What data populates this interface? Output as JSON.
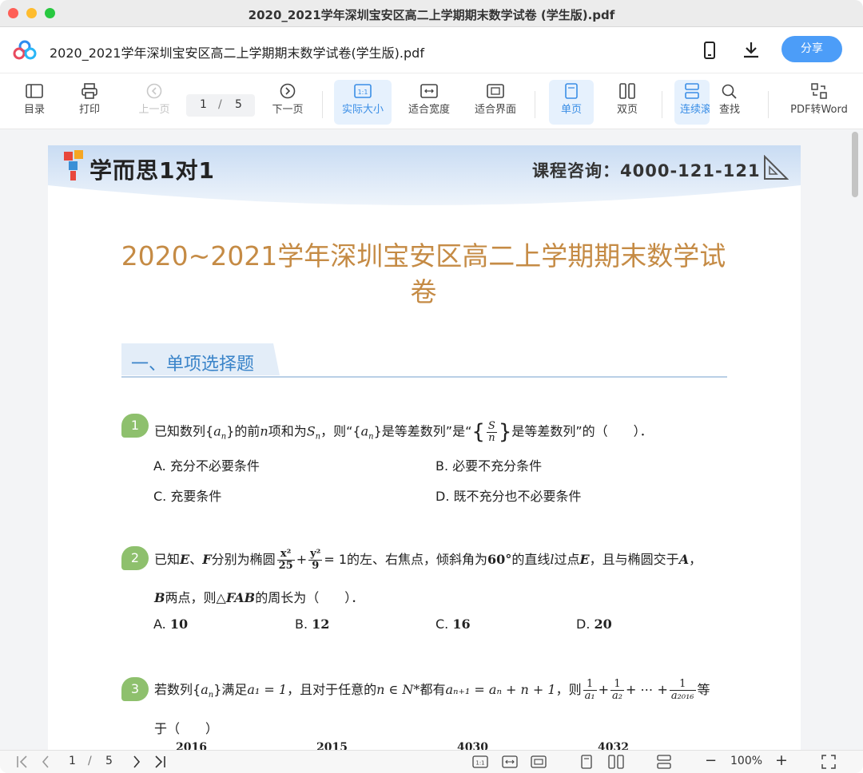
{
  "window": {
    "title": "2020_2021学年深圳宝安区高二上学期期末数学试卷 (学生版).pdf"
  },
  "header": {
    "filename": "2020_2021学年深圳宝安区高二上学期期末数学试卷(学生版).pdf",
    "share_label": "分享"
  },
  "toolbar": {
    "toc": "目录",
    "print": "打印",
    "prev": "上一页",
    "current_page": "1",
    "sep": "/",
    "total_pages": "5",
    "next": "下一页",
    "actual_size": "实际大小",
    "fit_width": "适合宽度",
    "fit_page": "适合界面",
    "single": "单页",
    "double": "双页",
    "continuous": "连续滚",
    "find": "查找",
    "pdf_to_word": "PDF转Word"
  },
  "page": {
    "brand": "学而思1对1",
    "consult": "课程咨询：4000-121-121",
    "title_line1": "2020~2021学年深圳宝安区高二上学期期末数学试",
    "title_line2": "卷",
    "section": "一、单项选择题",
    "q1": {
      "num": "1",
      "t1": "已知数列{",
      "an": "a",
      "sub_n": "n",
      "t2": "}的前",
      "n": "n",
      "t3": "项和为",
      "S": "S",
      "t4": "，则“{",
      "t5": "}是等差数列”是“",
      "frac_num": "S",
      "frac_den": "n",
      "t6": "是等差数列”的（　　）．",
      "A": "A.  充分不必要条件",
      "B": "B.  必要不充分条件",
      "C": "C.  充要条件",
      "D": "D.  既不充分也不必要条件"
    },
    "q2": {
      "num": "2",
      "t1": "已知",
      "E": "E",
      "t2": "、",
      "F": "F",
      "t3": "分别为椭圆",
      "fx_num": "x²",
      "fx_den": "25",
      "plus": "+",
      "fy_num": "y²",
      "fy_den": "9",
      "t4": "= 1的左、右焦点，倾斜角为",
      "deg": "60°",
      "t5": "的直线",
      "l": "l",
      "t6": "过点",
      "t7": "，且与椭圆交于",
      "A": "A",
      "t8": "，",
      "line2_B": "B",
      "line2_t": "两点，则△",
      "FAB": "FAB",
      "line2_end": "的周长为（　　）．",
      "optA": "A.",
      "valA": "10",
      "optB": "B.",
      "valB": "12",
      "optC": "C.",
      "valC": "16",
      "optD": "D.",
      "valD": "20"
    },
    "q3": {
      "num": "3",
      "t1": "若数列{",
      "t2": "}满足",
      "a1": "a₁ = 1",
      "t3": "，且对于任意的",
      "cond": "n ∈ N*",
      "t4": "都有",
      "rec": "aₙ₊₁ = aₙ + n + 1",
      "t5": "，则",
      "f1_num": "1",
      "f1_den": "a₁",
      "f2_num": "1",
      "f2_den": "a₂",
      "dots": "+ ⋯ +",
      "f3_num": "1",
      "f3_den": "a₂₀₁₆",
      "t6": "等",
      "line2": "于（　　）",
      "opts": [
        "2016",
        "2015",
        "4030",
        "4032"
      ]
    }
  },
  "bottombar": {
    "page": "1",
    "sep": "/",
    "total": "5",
    "zoom": "100%",
    "minus": "−",
    "plus": "+"
  }
}
